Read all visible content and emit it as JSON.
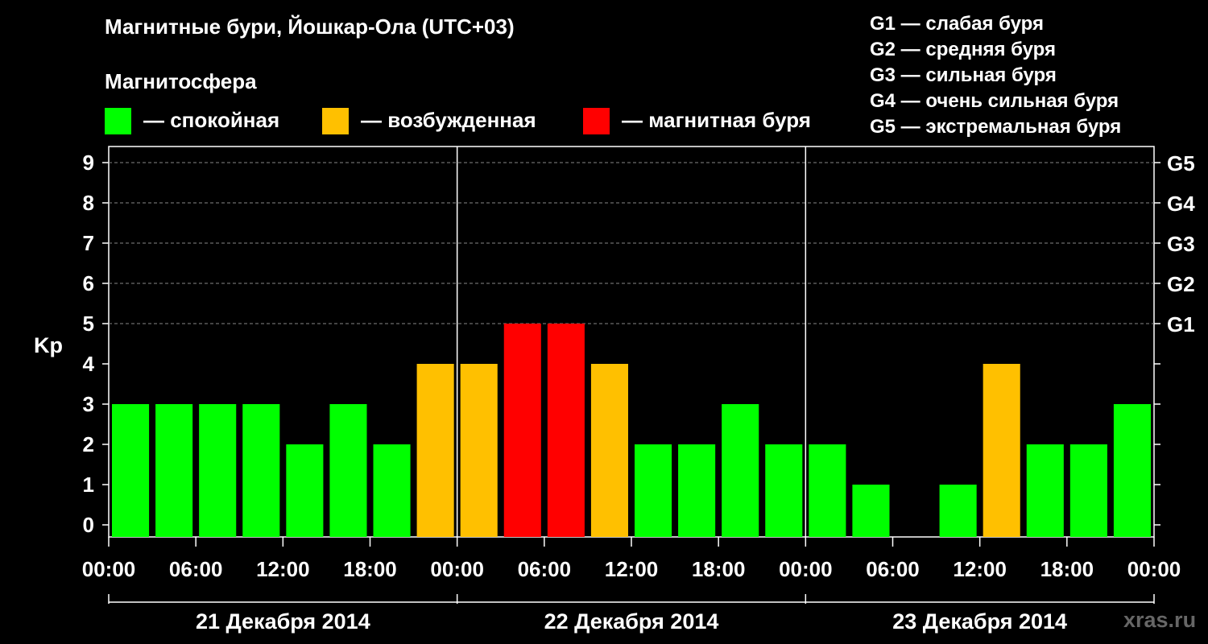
{
  "title": "Магнитные бури, Йошкар-Ола (UTC+03)",
  "legend": {
    "heading": "Магнитосфера",
    "items": [
      {
        "label": "— спокойная",
        "color": "#00ff00"
      },
      {
        "label": "— возбужденная",
        "color": "#ffc000"
      },
      {
        "label": "— магнитная буря",
        "color": "#ff0000"
      }
    ]
  },
  "g_scale": [
    "G1 — слабая буря",
    "G2 — средняя буря",
    "G3 — сильная буря",
    "G4 — очень сильная буря",
    "G5 — экстремальная буря"
  ],
  "watermark": "xras.ru",
  "chart_data": {
    "type": "bar",
    "ylabel": "Kp",
    "ylim": [
      0,
      9
    ],
    "yticks": [
      "0",
      "1",
      "2",
      "3",
      "4",
      "5",
      "6",
      "7",
      "8",
      "9"
    ],
    "right_labels": [
      {
        "label": "G1",
        "kp": 5
      },
      {
        "label": "G2",
        "kp": 6
      },
      {
        "label": "G3",
        "kp": 7
      },
      {
        "label": "G4",
        "kp": 8
      },
      {
        "label": "G5",
        "kp": 9
      }
    ],
    "grid": true,
    "xtick_labels": [
      "00:00",
      "06:00",
      "12:00",
      "18:00",
      "00:00",
      "06:00",
      "12:00",
      "18:00",
      "00:00",
      "06:00",
      "12:00",
      "18:00",
      "00:00"
    ],
    "days": [
      "21 Декабря 2014",
      "22 Декабря 2014",
      "23 Декабря 2014"
    ],
    "interval_hours": 3,
    "values": [
      3,
      3,
      3,
      3,
      2,
      3,
      2,
      4,
      4,
      5,
      5,
      4,
      2,
      2,
      3,
      2,
      2,
      1,
      0,
      1,
      4,
      2,
      2,
      3
    ],
    "colors": {
      "quiet": "#00ff00",
      "active": "#ffc000",
      "storm": "#ff0000"
    }
  }
}
